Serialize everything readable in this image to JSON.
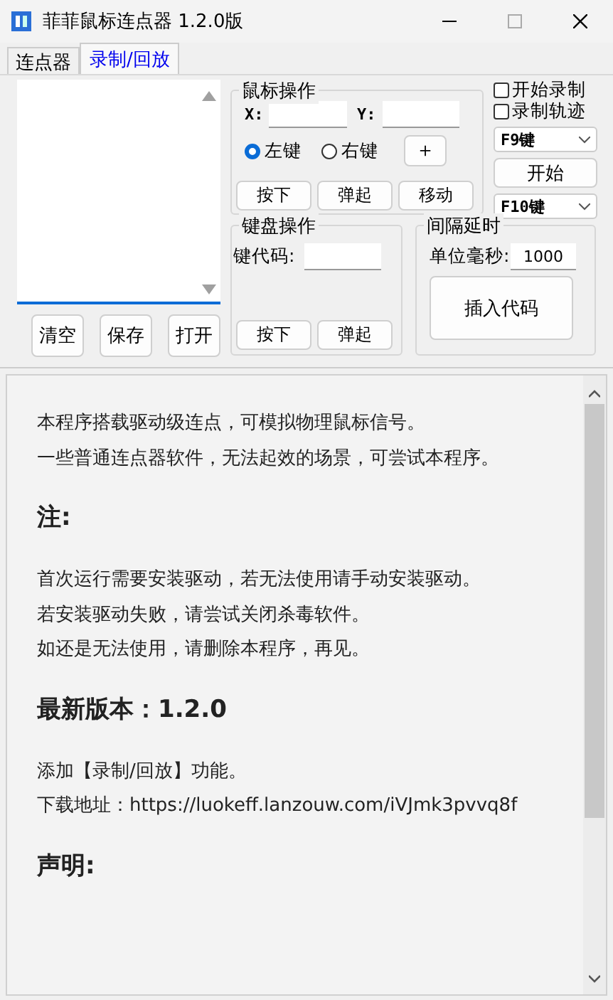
{
  "window": {
    "title": "菲菲鼠标连点器 1.2.0版"
  },
  "tabs": [
    {
      "label": "连点器",
      "selected": false
    },
    {
      "label": "录制/回放",
      "selected": true
    }
  ],
  "record_list": {
    "buttons": [
      "清空",
      "保存",
      "打开"
    ]
  },
  "mouse_group": {
    "title": "鼠标操作",
    "x_label": "X:",
    "y_label": "Y:",
    "add_button": "＋",
    "actions": [
      "按下",
      "弹起",
      "移动"
    ],
    "mouse_buttons": [
      {
        "label": "左键",
        "selected": true
      },
      {
        "label": "右键",
        "selected": false
      }
    ]
  },
  "keyboard_group": {
    "title": "键盘操作",
    "key_code_label": "键代码:",
    "actions": [
      "按下",
      "弹起"
    ]
  },
  "delay_group": {
    "title": "间隔延时",
    "unit_label": "单位毫秒:",
    "value": "1000",
    "insert_button": "插入代码"
  },
  "record_controls": {
    "checkboxes": [
      {
        "label": "开始录制",
        "checked": false
      },
      {
        "label": "录制轨迹",
        "checked": false
      }
    ],
    "record_hotkey": "F9键",
    "start_button": "开始",
    "play_hotkey": "F10键"
  },
  "info": [
    {
      "kind": "text",
      "text": "本程序搭载驱动级连点，可模拟物理鼠标信号。"
    },
    {
      "kind": "text",
      "text": "一些普通连点器软件，无法起效的场景，可尝试本程序。"
    },
    {
      "kind": "heading",
      "text": "注:"
    },
    {
      "kind": "text",
      "text": "首次运行需要安装驱动，若无法使用请手动安装驱动。"
    },
    {
      "kind": "text",
      "text": "若安装驱动失败，请尝试关闭杀毒软件。"
    },
    {
      "kind": "text",
      "text": "如还是无法使用，请删除本程序，再见。"
    },
    {
      "kind": "heading",
      "text": "最新版本：1.2.0"
    },
    {
      "kind": "text",
      "text": "添加【录制/回放】功能。"
    },
    {
      "kind": "text",
      "text": "下载地址：https://luokeff.lanzouw.com/iVJmk3pvvq8f"
    },
    {
      "kind": "heading",
      "text": "声明:"
    }
  ]
}
